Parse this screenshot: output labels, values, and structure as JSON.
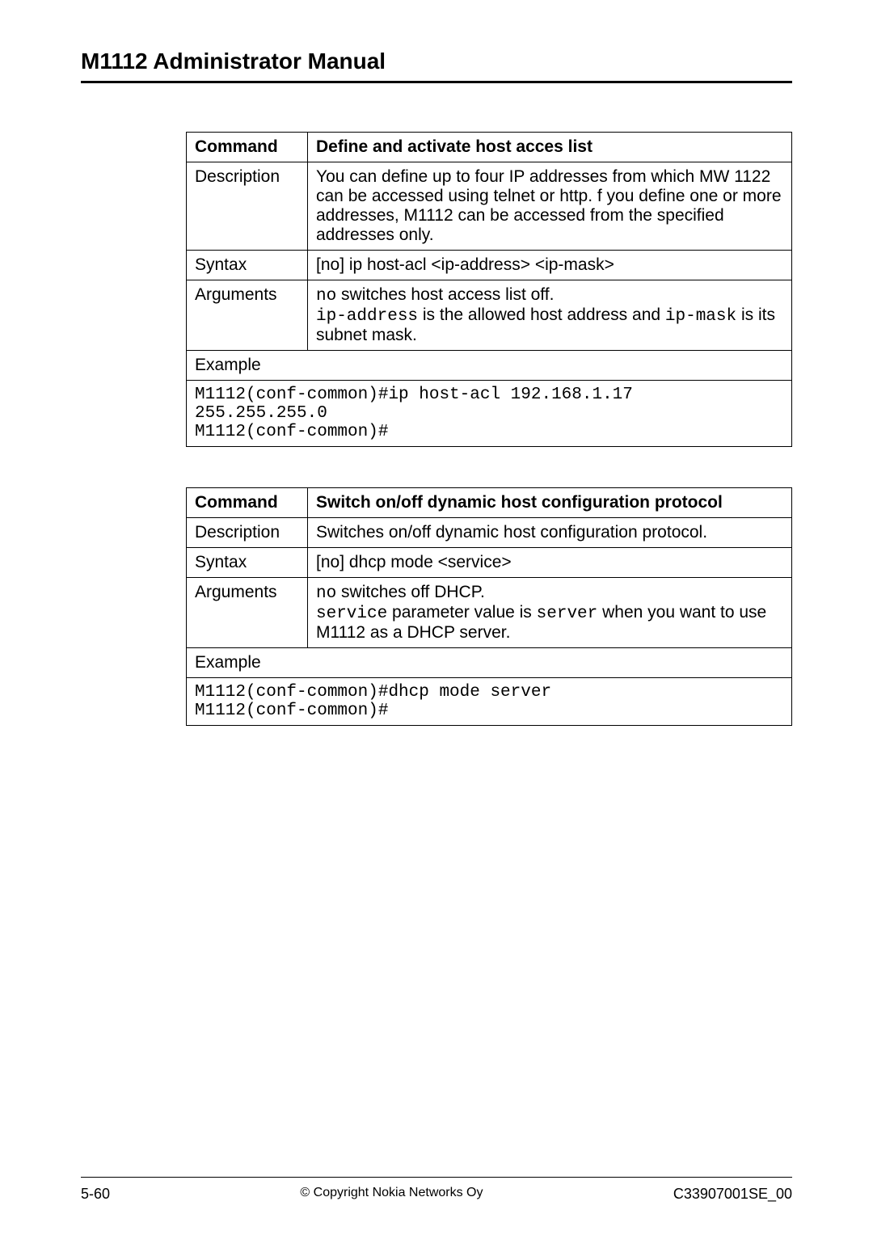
{
  "header": {
    "title": "M1112 Administrator Manual"
  },
  "table1": {
    "command_label": "Command",
    "command_value": "Define and activate host acces list",
    "description_label": "Description",
    "description_value": "You can define up to four IP addresses from which MW 1122 can be accessed using telnet or http. f you define one or more addresses, M1112 can be accessed from the specified addresses only.",
    "syntax_label": "Syntax",
    "syntax_value": "[no] ip host-acl <ip-address> <ip-mask>",
    "arguments_label": "Arguments",
    "arg_line1_pre": "no",
    "arg_line1_post": " switches host access list off.",
    "arg_line2_a": "ip-address",
    "arg_line2_b": " is the allowed host address and ",
    "arg_line2_c": "ip-mask",
    "arg_line2_d": " is its subnet mask.",
    "example_label": "Example",
    "example_code": "M1112(conf-common)#ip host-acl 192.168.1.17\n255.255.255.0\nM1112(conf-common)#"
  },
  "table2": {
    "command_label": "Command",
    "command_value": "Switch on/off dynamic host configuration protocol",
    "description_label": "Description",
    "description_value": "Switches on/off dynamic host configuration protocol.",
    "syntax_label": "Syntax",
    "syntax_value": "[no] dhcp mode <service>",
    "arguments_label": "Arguments",
    "arg_line1_pre": "no",
    "arg_line1_post": "  switches off DHCP.",
    "arg_line2_a": "service",
    "arg_line2_b": " parameter value is ",
    "arg_line2_c": "server",
    "arg_line2_d": " when you want to use M1112 as a DHCP server.",
    "example_label": "Example",
    "example_code": "M1112(conf-common)#dhcp mode server\nM1112(conf-common)#"
  },
  "footer": {
    "left": "5-60",
    "center": "© Copyright Nokia Networks Oy",
    "right": "C33907001SE_00"
  }
}
